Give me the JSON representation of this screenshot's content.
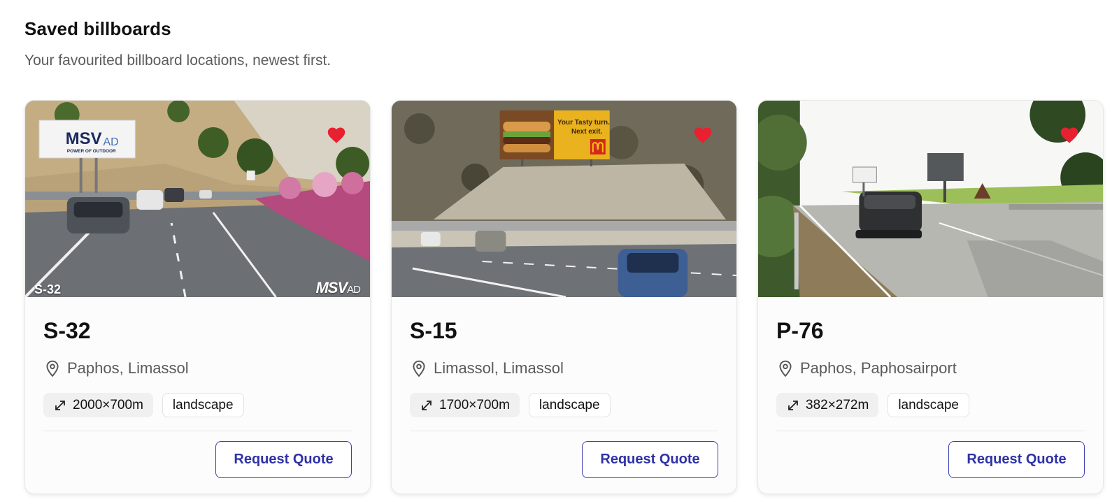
{
  "header": {
    "title": "Saved billboards",
    "subtitle": "Your favourited billboard locations, newest first."
  },
  "colors": {
    "accent": "#2e32a6",
    "heart": "#e8202f",
    "muted_text": "#5a5a5a"
  },
  "cards": [
    {
      "code": "S-32",
      "location": "Paphos, Limassol",
      "size": "2000×700m",
      "orientation": "landscape",
      "action_label": "Request Quote",
      "image_overlay_code": "S-32",
      "image_overlay_brand": "MSV",
      "image_overlay_brand_suffix": "AD",
      "billboard_brand": "MSV",
      "billboard_brand_suffix": "AD",
      "billboard_tagline": "POWER OF OUTDOOR",
      "favorited": true
    },
    {
      "code": "S-15",
      "location": "Limassol, Limassol",
      "size": "1700×700m",
      "orientation": "landscape",
      "action_label": "Request Quote",
      "billboard_line1": "Your Tasty turn.",
      "billboard_line2": "Next exit.",
      "favorited": true
    },
    {
      "code": "P-76",
      "location": "Paphos, Paphosairport",
      "size": "382×272m",
      "orientation": "landscape",
      "action_label": "Request Quote",
      "favorited": true
    }
  ]
}
